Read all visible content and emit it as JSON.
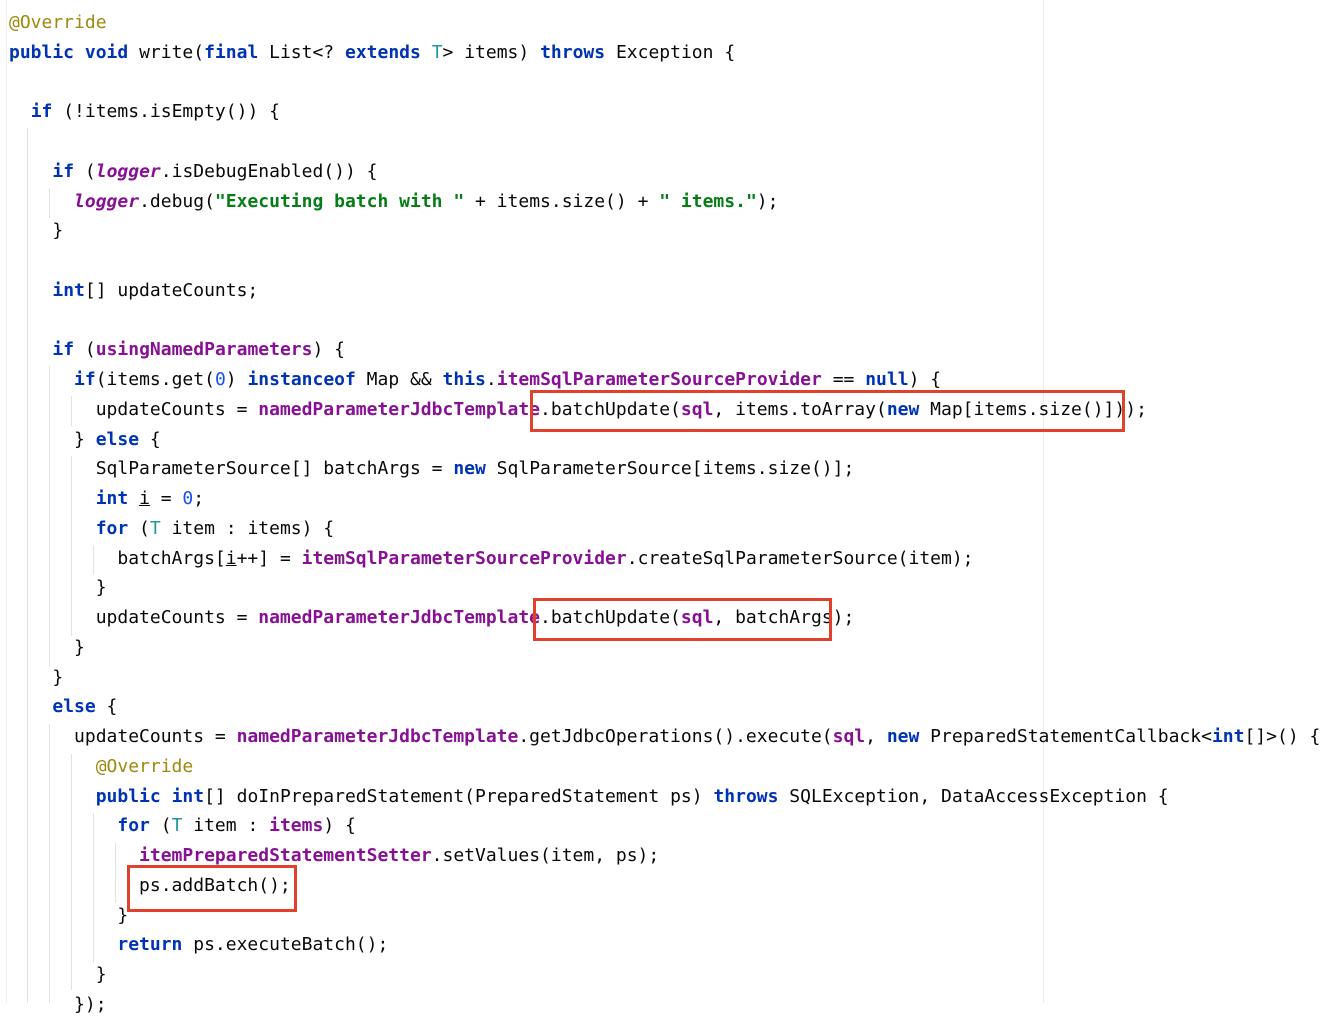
{
  "editor": {
    "lines": [
      [
        [
          "ann",
          "@Override"
        ]
      ],
      [
        [
          "kw",
          "public"
        ],
        [
          "p",
          " "
        ],
        [
          "kw",
          "void"
        ],
        [
          "p",
          " write("
        ],
        [
          "kw",
          "final"
        ],
        [
          "p",
          " List<? "
        ],
        [
          "kw",
          "extends"
        ],
        [
          "p",
          " "
        ],
        [
          "tp",
          "T"
        ],
        [
          "p",
          "> items) "
        ],
        [
          "kw",
          "throws"
        ],
        [
          "p",
          " Exception {"
        ]
      ],
      [],
      [
        [
          "p",
          "  "
        ],
        [
          "kw",
          "if"
        ],
        [
          "p",
          " (!items.isEmpty()) {"
        ]
      ],
      [],
      [
        [
          "p",
          "    "
        ],
        [
          "kw",
          "if"
        ],
        [
          "p",
          " ("
        ],
        [
          "static",
          "logger"
        ],
        [
          "p",
          ".isDebugEnabled()) {"
        ]
      ],
      [
        [
          "p",
          "      "
        ],
        [
          "static",
          "logger"
        ],
        [
          "p",
          ".debug("
        ],
        [
          "str",
          "\"Executing batch with \""
        ],
        [
          "p",
          " + items.size() + "
        ],
        [
          "str",
          "\" items.\""
        ],
        [
          "p",
          ");"
        ]
      ],
      [
        [
          "p",
          "    }"
        ]
      ],
      [],
      [
        [
          "p",
          "    "
        ],
        [
          "kw",
          "int"
        ],
        [
          "p",
          "[] updateCounts;"
        ]
      ],
      [],
      [
        [
          "p",
          "    "
        ],
        [
          "kw",
          "if"
        ],
        [
          "p",
          " ("
        ],
        [
          "fld",
          "usingNamedParameters"
        ],
        [
          "p",
          ") {"
        ]
      ],
      [
        [
          "p",
          "      "
        ],
        [
          "kw",
          "if"
        ],
        [
          "p",
          "(items.get("
        ],
        [
          "num",
          "0"
        ],
        [
          "p",
          ") "
        ],
        [
          "kw",
          "instanceof"
        ],
        [
          "p",
          " Map && "
        ],
        [
          "kw",
          "this"
        ],
        [
          "p",
          "."
        ],
        [
          "fld",
          "itemSqlParameterSourceProvider"
        ],
        [
          "p",
          " == "
        ],
        [
          "kw",
          "null"
        ],
        [
          "p",
          ") {"
        ]
      ],
      [
        [
          "p",
          "        updateCounts = "
        ],
        [
          "fld",
          "namedParameterJdbcTemplate"
        ],
        [
          "p",
          ".batchUpdate("
        ],
        [
          "fld",
          "sql"
        ],
        [
          "p",
          ", items.toArray("
        ],
        [
          "kw",
          "new"
        ],
        [
          "p",
          " Map[items.size()]));"
        ]
      ],
      [
        [
          "p",
          "      } "
        ],
        [
          "kw",
          "else"
        ],
        [
          "p",
          " {"
        ]
      ],
      [
        [
          "p",
          "        SqlParameterSource[] batchArgs = "
        ],
        [
          "kw",
          "new"
        ],
        [
          "p",
          " SqlParameterSource[items.size()];"
        ]
      ],
      [
        [
          "p",
          "        "
        ],
        [
          "kw",
          "int"
        ],
        [
          "p",
          " "
        ],
        [
          "var",
          "i"
        ],
        [
          "p",
          " = "
        ],
        [
          "num",
          "0"
        ],
        [
          "p",
          ";"
        ]
      ],
      [
        [
          "p",
          "        "
        ],
        [
          "kw",
          "for"
        ],
        [
          "p",
          " ("
        ],
        [
          "tp",
          "T"
        ],
        [
          "p",
          " item : items) {"
        ]
      ],
      [
        [
          "p",
          "          batchArgs["
        ],
        [
          "var",
          "i"
        ],
        [
          "p",
          "++] = "
        ],
        [
          "fld",
          "itemSqlParameterSourceProvider"
        ],
        [
          "p",
          ".createSqlParameterSource(item);"
        ]
      ],
      [
        [
          "p",
          "        }"
        ]
      ],
      [
        [
          "p",
          "        updateCounts = "
        ],
        [
          "fld",
          "namedParameterJdbcTemplate"
        ],
        [
          "p",
          ".batchUpdate("
        ],
        [
          "fld",
          "sql"
        ],
        [
          "p",
          ", batchArgs);"
        ]
      ],
      [
        [
          "p",
          "      }"
        ]
      ],
      [
        [
          "p",
          "    }"
        ]
      ],
      [
        [
          "p",
          "    "
        ],
        [
          "kw",
          "else"
        ],
        [
          "p",
          " {"
        ]
      ],
      [
        [
          "p",
          "      updateCounts = "
        ],
        [
          "fld",
          "namedParameterJdbcTemplate"
        ],
        [
          "p",
          ".getJdbcOperations().execute("
        ],
        [
          "fld",
          "sql"
        ],
        [
          "p",
          ", "
        ],
        [
          "kw",
          "new"
        ],
        [
          "p",
          " PreparedStatementCallback<"
        ],
        [
          "kw",
          "int"
        ],
        [
          "p",
          "[]>() {"
        ]
      ],
      [
        [
          "p",
          "        "
        ],
        [
          "ann",
          "@Override"
        ]
      ],
      [
        [
          "p",
          "        "
        ],
        [
          "kw",
          "public"
        ],
        [
          "p",
          " "
        ],
        [
          "kw",
          "int"
        ],
        [
          "p",
          "[] doInPreparedStatement(PreparedStatement ps) "
        ],
        [
          "kw",
          "throws"
        ],
        [
          "p",
          " SQLException, DataAccessException {"
        ]
      ],
      [
        [
          "p",
          "          "
        ],
        [
          "kw",
          "for"
        ],
        [
          "p",
          " ("
        ],
        [
          "tp",
          "T"
        ],
        [
          "p",
          " item : "
        ],
        [
          "fld",
          "items"
        ],
        [
          "p",
          ") {"
        ]
      ],
      [
        [
          "p",
          "            "
        ],
        [
          "fld",
          "itemPreparedStatementSetter"
        ],
        [
          "p",
          ".setValues(item, ps);"
        ]
      ],
      [
        [
          "p",
          "            ps.addBatch();"
        ]
      ],
      [
        [
          "p",
          "          }"
        ]
      ],
      [
        [
          "p",
          "          "
        ],
        [
          "kw",
          "return"
        ],
        [
          "p",
          " ps.executeBatch();"
        ]
      ],
      [
        [
          "p",
          "        }"
        ]
      ],
      [
        [
          "p",
          "      });"
        ]
      ]
    ]
  },
  "highlights": [
    {
      "label": "batchUpdate(sql, items.toArray(new Map[items.size()]));"
    },
    {
      "label": "batchUpdate(sql, batchArgs);"
    },
    {
      "label": "ps.addBatch();"
    }
  ],
  "colors": {
    "keyword": "#0033b3",
    "annotation": "#9e880d",
    "field": "#871094",
    "string": "#067d17",
    "number": "#1750eb",
    "type_param": "#20999d",
    "highlight_box": "#e0412c"
  }
}
